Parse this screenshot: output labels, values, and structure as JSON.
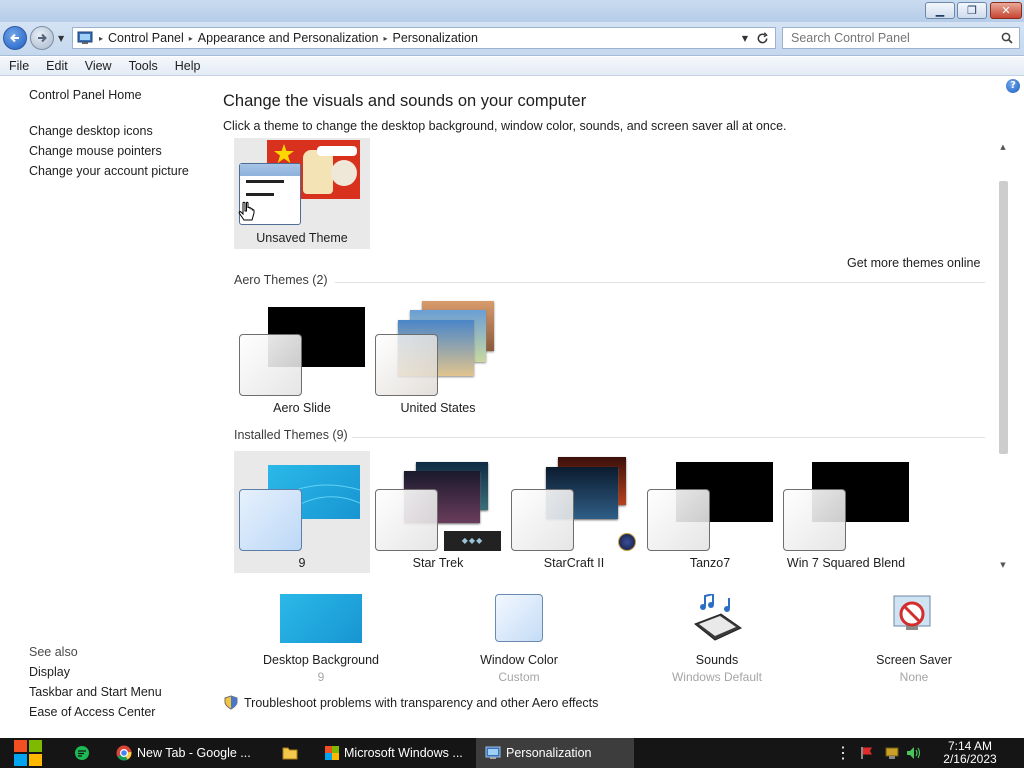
{
  "window": {
    "minimize_icon": "minimize-icon",
    "maximize_icon": "restore-icon",
    "close_icon": "close-icon"
  },
  "address": {
    "breadcrumbs": [
      "Control Panel",
      "Appearance and Personalization",
      "Personalization"
    ],
    "search_placeholder": "Search Control Panel"
  },
  "menu": [
    "File",
    "Edit",
    "View",
    "Tools",
    "Help"
  ],
  "sidebar": {
    "home": "Control Panel Home",
    "links": [
      "Change desktop icons",
      "Change mouse pointers",
      "Change your account picture"
    ],
    "see_also_title": "See also",
    "see_also": [
      "Display",
      "Taskbar and Start Menu",
      "Ease of Access Center"
    ]
  },
  "main": {
    "title": "Change the visuals and sounds on your computer",
    "subtitle": "Click a theme to change the desktop background, window color, sounds, and screen saver all at once.",
    "my_themes": [
      {
        "name": "Unsaved Theme",
        "selected": true
      }
    ],
    "get_more": "Get more themes online",
    "aero_title": "Aero Themes (2)",
    "aero_themes": [
      "Aero Slide",
      "United States"
    ],
    "installed_title": "Installed Themes (9)",
    "installed_themes": [
      "9",
      "Star Trek",
      "StarCraft II",
      "Tanzo7",
      "Win 7 Squared Blend"
    ],
    "selected_installed": "9"
  },
  "customize": [
    {
      "label": "Desktop Background",
      "value": "9"
    },
    {
      "label": "Window Color",
      "value": "Custom"
    },
    {
      "label": "Sounds",
      "value": "Windows Default"
    },
    {
      "label": "Screen Saver",
      "value": "None"
    }
  ],
  "troubleshoot": "Troubleshoot problems with transparency and other Aero effects",
  "taskbar": {
    "items": [
      "New Tab - Google ...",
      "Microsoft Windows ...",
      "Personalization"
    ],
    "active": "Personalization",
    "time": "7:14 AM",
    "date": "2/16/2023"
  },
  "colors": {
    "selection_bg": "#e9e9e9",
    "taskbar_bg": "#151515",
    "link_color": "#1e1e1e",
    "accent_blue": "#2160c4"
  }
}
